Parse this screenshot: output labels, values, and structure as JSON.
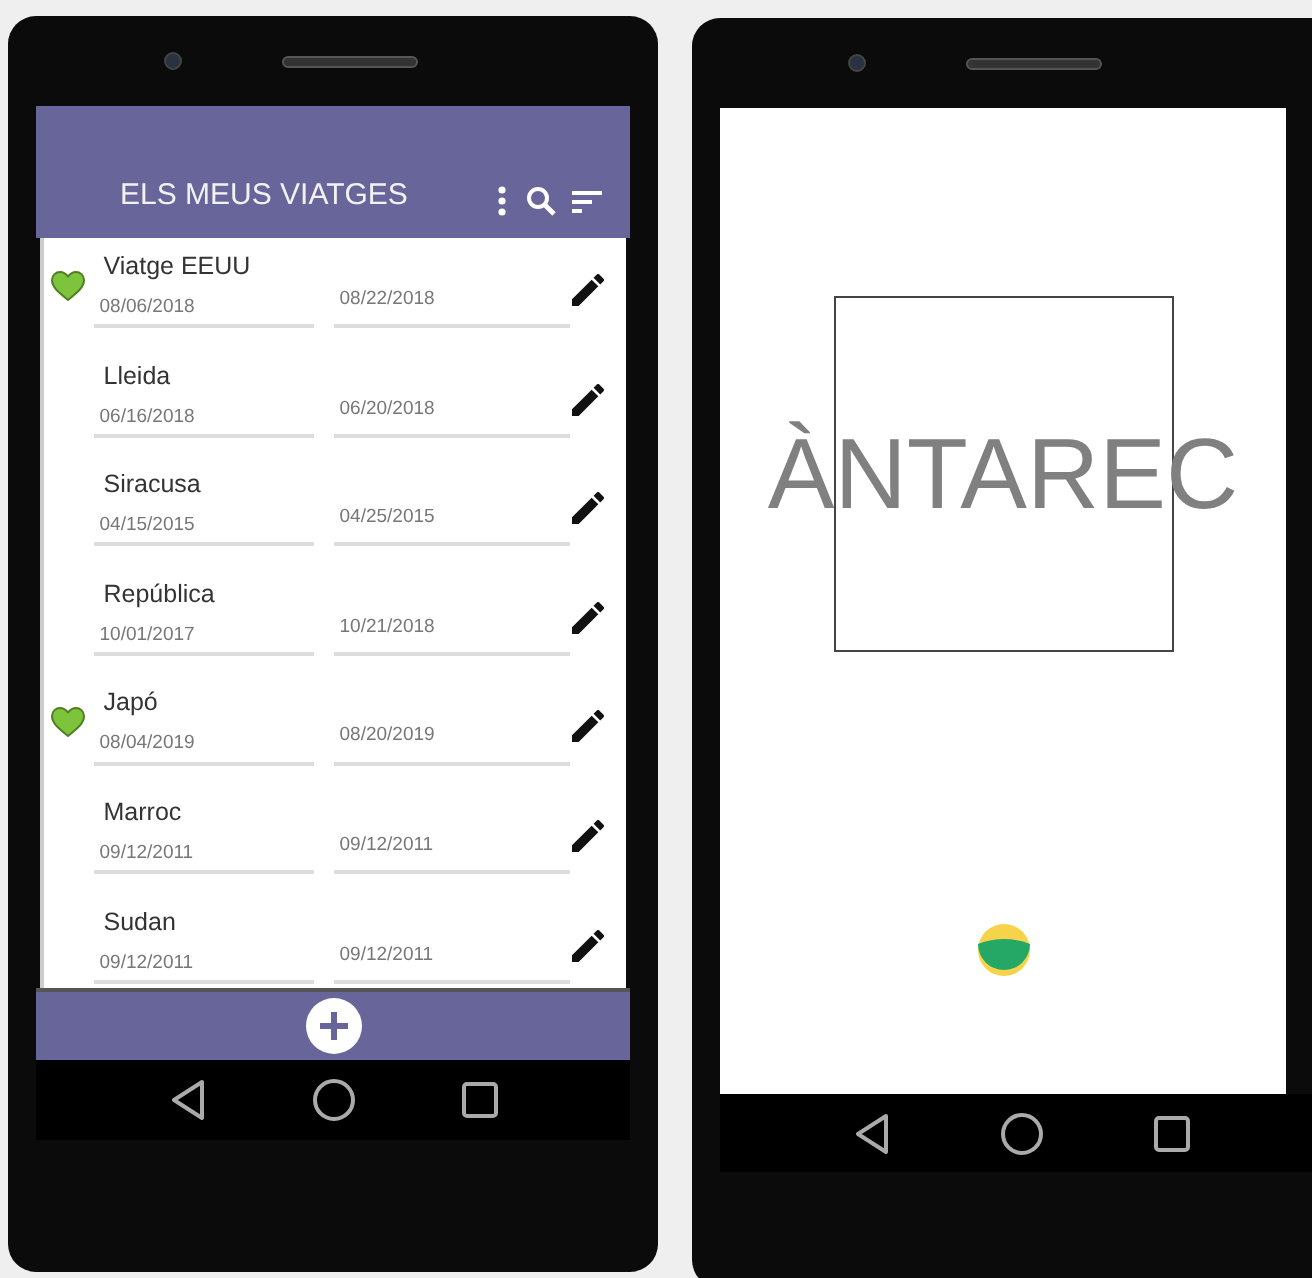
{
  "trips_screen": {
    "app_bar": {
      "title": "ELS MEUS VIATGES"
    },
    "trips": [
      {
        "name": "Viatge EEUU",
        "start_date": "08/06/2018",
        "end_date": "08/22/2018",
        "favorite": true
      },
      {
        "name": "Lleida",
        "start_date": "06/16/2018",
        "end_date": "06/20/2018",
        "favorite": false
      },
      {
        "name": "Siracusa",
        "start_date": "04/15/2015",
        "end_date": "04/25/2015",
        "favorite": false
      },
      {
        "name": "República",
        "start_date": "10/01/2017",
        "end_date": "10/21/2018",
        "favorite": false
      },
      {
        "name": "Japó",
        "start_date": "08/04/2019",
        "end_date": "08/20/2019",
        "favorite": true
      },
      {
        "name": "Marroc",
        "start_date": "09/12/2011",
        "end_date": "09/12/2011",
        "favorite": false
      },
      {
        "name": "Sudan",
        "start_date": "09/12/2011",
        "end_date": "09/12/2011",
        "favorite": false
      }
    ]
  },
  "splash_screen": {
    "title": "ÀNTAREC"
  }
}
